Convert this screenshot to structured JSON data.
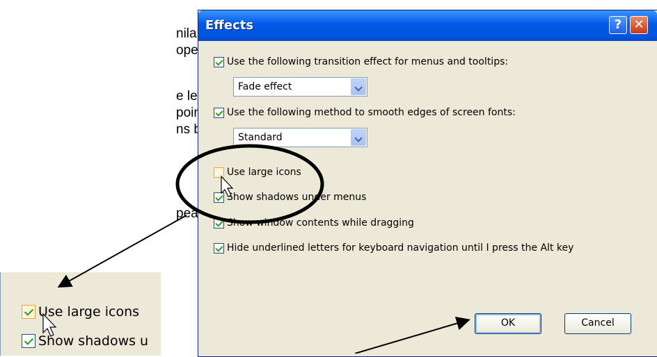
{
  "document": {
    "lines": [
      "nilar to the one",
      "opear –",
      "e left mouse",
      "pointing to the",
      "ns box",
      "pear in the box"
    ]
  },
  "dialog": {
    "title": "Effects",
    "help_glyph": "?",
    "close_glyph": "✕",
    "transition_label": "Use the following transition effect for menus and tooltips:",
    "transition_value": "Fade effect",
    "smooth_label": "Use the following method to smooth edges of screen fonts:",
    "smooth_value": "Standard",
    "large_icons_label": "Use large icons",
    "shadows_label": "Show shadows under menus",
    "window_contents_label": "Show window contents while dragging",
    "underline_label": "Hide underlined letters for keyboard navigation until I press the Alt key",
    "ok_label": "OK",
    "cancel_label": "Cancel"
  },
  "inset": {
    "large_icons_label": "Use large icons",
    "shadows_label": "Show shadows u"
  },
  "colors": {
    "titlebar": "#0058e6",
    "dialog_bg": "#ece9d8",
    "check": "#21a121"
  }
}
